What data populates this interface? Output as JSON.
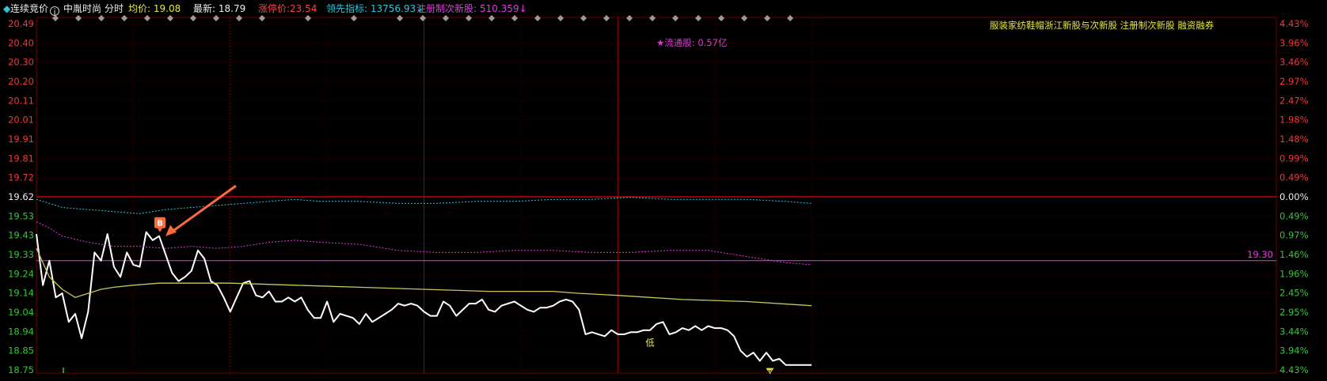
{
  "header": {
    "auction_label": "连续竞价",
    "stock_name": "中胤时尚",
    "mode_label": "分时",
    "avg_price": "均价: 19.08",
    "latest": "最新: 18.79",
    "limit_up": "涨停价:23.54",
    "lead_indicator": "领先指标: 13756.93↓",
    "registration": "注册制次新股: 510.359↓"
  },
  "tags": "服装家纺鞋帽浙江新股与次新股 注册制次新股 融资融券",
  "float_shares": "★流通股: 0.57亿",
  "buy_marker": "B",
  "low_marker": "低",
  "ref_price_label": "19.30",
  "colors": {
    "price_line": "#ffffff",
    "avg_line": "#c8c85a",
    "lead_line": "#28c8dc",
    "reg_line": "#dc3cdc",
    "grid": "#6e0000",
    "up": "#ff3232",
    "down": "#32c832",
    "accent": "#ff6a3c"
  },
  "chart_data": {
    "type": "line",
    "prev_close": 19.62,
    "y_ticks_left": [
      {
        "v": "20.49",
        "c": "up"
      },
      {
        "v": "20.40",
        "c": "up"
      },
      {
        "v": "20.30",
        "c": "up"
      },
      {
        "v": "20.20",
        "c": "up"
      },
      {
        "v": "20.11",
        "c": "up"
      },
      {
        "v": "20.01",
        "c": "up"
      },
      {
        "v": "19.91",
        "c": "up"
      },
      {
        "v": "19.81",
        "c": "up"
      },
      {
        "v": "19.72",
        "c": "up"
      },
      {
        "v": "19.62",
        "c": "flat"
      },
      {
        "v": "19.53",
        "c": "down"
      },
      {
        "v": "19.43",
        "c": "down"
      },
      {
        "v": "19.33",
        "c": "down"
      },
      {
        "v": "19.24",
        "c": "down"
      },
      {
        "v": "19.14",
        "c": "down"
      },
      {
        "v": "19.04",
        "c": "down"
      },
      {
        "v": "18.94",
        "c": "down"
      },
      {
        "v": "18.85",
        "c": "down"
      },
      {
        "v": "18.75",
        "c": "down"
      }
    ],
    "y_ticks_right": [
      {
        "v": "4.43%",
        "c": "up"
      },
      {
        "v": "3.96%",
        "c": "up"
      },
      {
        "v": "3.46%",
        "c": "up"
      },
      {
        "v": "2.97%",
        "c": "up"
      },
      {
        "v": "2.47%",
        "c": "up"
      },
      {
        "v": "1.98%",
        "c": "up"
      },
      {
        "v": "1.48%",
        "c": "up"
      },
      {
        "v": "0.99%",
        "c": "up"
      },
      {
        "v": "0.49%",
        "c": "up"
      },
      {
        "v": "0.00%",
        "c": "flat"
      },
      {
        "v": "0.49%",
        "c": "down"
      },
      {
        "v": "0.97%",
        "c": "down"
      },
      {
        "v": "1.46%",
        "c": "down"
      },
      {
        "v": "1.96%",
        "c": "down"
      },
      {
        "v": "2.45%",
        "c": "down"
      },
      {
        "v": "2.95%",
        "c": "down"
      },
      {
        "v": "3.44%",
        "c": "down"
      },
      {
        "v": "3.94%",
        "c": "down"
      },
      {
        "v": "4.43%",
        "c": "down"
      }
    ],
    "ylim": [
      18.75,
      20.49
    ],
    "session_minutes": 240,
    "ref_price": 19.3,
    "buy_minute": 38,
    "low_minute": 190,
    "series": [
      {
        "key": "price",
        "values": [
          [
            0,
            19.43
          ],
          [
            2,
            19.18
          ],
          [
            4,
            19.3
          ],
          [
            6,
            19.12
          ],
          [
            8,
            19.14
          ],
          [
            10,
            19.0
          ],
          [
            12,
            19.04
          ],
          [
            14,
            18.92
          ],
          [
            16,
            19.05
          ],
          [
            18,
            19.34
          ],
          [
            20,
            19.3
          ],
          [
            22,
            19.43
          ],
          [
            24,
            19.27
          ],
          [
            26,
            19.22
          ],
          [
            28,
            19.34
          ],
          [
            30,
            19.28
          ],
          [
            32,
            19.27
          ],
          [
            34,
            19.44
          ],
          [
            36,
            19.4
          ],
          [
            38,
            19.42
          ],
          [
            40,
            19.33
          ],
          [
            42,
            19.24
          ],
          [
            44,
            19.2
          ],
          [
            46,
            19.22
          ],
          [
            48,
            19.25
          ],
          [
            50,
            19.35
          ],
          [
            52,
            19.31
          ],
          [
            54,
            19.2
          ],
          [
            56,
            19.18
          ],
          [
            58,
            19.12
          ],
          [
            60,
            19.05
          ],
          [
            62,
            19.12
          ],
          [
            64,
            19.19
          ],
          [
            66,
            19.2
          ],
          [
            68,
            19.13
          ],
          [
            70,
            19.12
          ],
          [
            72,
            19.15
          ],
          [
            74,
            19.1
          ],
          [
            76,
            19.1
          ],
          [
            78,
            19.12
          ],
          [
            80,
            19.1
          ],
          [
            82,
            19.12
          ],
          [
            84,
            19.06
          ],
          [
            86,
            19.02
          ],
          [
            88,
            19.02
          ],
          [
            90,
            19.1
          ],
          [
            92,
            19.0
          ],
          [
            94,
            19.04
          ],
          [
            96,
            19.03
          ],
          [
            98,
            19.02
          ],
          [
            100,
            18.99
          ],
          [
            102,
            19.04
          ],
          [
            104,
            19.0
          ],
          [
            106,
            19.02
          ],
          [
            108,
            19.04
          ],
          [
            110,
            19.06
          ],
          [
            112,
            19.09
          ],
          [
            114,
            19.08
          ],
          [
            116,
            19.09
          ],
          [
            118,
            19.08
          ],
          [
            120,
            19.05
          ],
          [
            122,
            19.03
          ],
          [
            124,
            19.03
          ],
          [
            126,
            19.1
          ],
          [
            128,
            19.08
          ],
          [
            130,
            19.03
          ],
          [
            132,
            19.06
          ],
          [
            134,
            19.09
          ],
          [
            136,
            19.09
          ],
          [
            138,
            19.11
          ],
          [
            140,
            19.06
          ],
          [
            142,
            19.05
          ],
          [
            144,
            19.08
          ],
          [
            146,
            19.09
          ],
          [
            148,
            19.1
          ],
          [
            150,
            19.08
          ],
          [
            152,
            19.06
          ],
          [
            154,
            19.05
          ],
          [
            156,
            19.07
          ],
          [
            158,
            19.07
          ],
          [
            160,
            19.08
          ],
          [
            162,
            19.1
          ],
          [
            164,
            19.11
          ],
          [
            166,
            19.1
          ],
          [
            168,
            19.06
          ],
          [
            170,
            18.94
          ],
          [
            172,
            18.95
          ],
          [
            174,
            18.94
          ],
          [
            176,
            18.93
          ],
          [
            178,
            18.96
          ],
          [
            180,
            18.94
          ],
          [
            182,
            18.94
          ],
          [
            184,
            18.95
          ],
          [
            186,
            18.95
          ],
          [
            188,
            18.96
          ],
          [
            190,
            18.96
          ],
          [
            192,
            18.99
          ],
          [
            194,
            19.0
          ],
          [
            196,
            18.94
          ],
          [
            198,
            18.95
          ],
          [
            200,
            18.97
          ],
          [
            202,
            18.96
          ],
          [
            204,
            18.98
          ],
          [
            206,
            18.96
          ],
          [
            208,
            18.98
          ],
          [
            210,
            18.97
          ],
          [
            212,
            18.97
          ],
          [
            214,
            18.96
          ],
          [
            216,
            18.93
          ],
          [
            218,
            18.86
          ],
          [
            220,
            18.83
          ],
          [
            222,
            18.85
          ],
          [
            224,
            18.81
          ],
          [
            226,
            18.85
          ],
          [
            228,
            18.81
          ],
          [
            230,
            18.82
          ],
          [
            232,
            18.79
          ],
          [
            234,
            18.79
          ],
          [
            236,
            18.79
          ],
          [
            238,
            18.79
          ],
          [
            240,
            18.79
          ]
        ]
      },
      {
        "key": "avg",
        "values": [
          [
            0,
            19.36
          ],
          [
            4,
            19.22
          ],
          [
            8,
            19.16
          ],
          [
            12,
            19.12
          ],
          [
            16,
            19.14
          ],
          [
            20,
            19.16
          ],
          [
            24,
            19.17
          ],
          [
            30,
            19.18
          ],
          [
            38,
            19.19
          ],
          [
            46,
            19.19
          ],
          [
            60,
            19.19
          ],
          [
            80,
            19.18
          ],
          [
            100,
            19.17
          ],
          [
            120,
            19.16
          ],
          [
            140,
            19.15
          ],
          [
            160,
            19.15
          ],
          [
            168,
            19.14
          ],
          [
            180,
            19.13
          ],
          [
            200,
            19.11
          ],
          [
            220,
            19.1
          ],
          [
            240,
            19.08
          ]
        ]
      },
      {
        "key": "lead",
        "values": [
          [
            0,
            19.6
          ],
          [
            4,
            19.58
          ],
          [
            8,
            19.56
          ],
          [
            16,
            19.55
          ],
          [
            24,
            19.54
          ],
          [
            32,
            19.53
          ],
          [
            40,
            19.55
          ],
          [
            48,
            19.56
          ],
          [
            56,
            19.57
          ],
          [
            64,
            19.58
          ],
          [
            72,
            19.59
          ],
          [
            80,
            19.6
          ],
          [
            88,
            19.59
          ],
          [
            100,
            19.59
          ],
          [
            112,
            19.58
          ],
          [
            124,
            19.58
          ],
          [
            136,
            19.59
          ],
          [
            148,
            19.59
          ],
          [
            160,
            19.6
          ],
          [
            172,
            19.6
          ],
          [
            184,
            19.61
          ],
          [
            196,
            19.6
          ],
          [
            208,
            19.6
          ],
          [
            220,
            19.6
          ],
          [
            232,
            19.59
          ],
          [
            240,
            19.58
          ]
        ]
      },
      {
        "key": "reg",
        "values": [
          [
            0,
            19.49
          ],
          [
            4,
            19.46
          ],
          [
            8,
            19.42
          ],
          [
            16,
            19.39
          ],
          [
            24,
            19.37
          ],
          [
            32,
            19.37
          ],
          [
            40,
            19.36
          ],
          [
            48,
            19.37
          ],
          [
            56,
            19.36
          ],
          [
            64,
            19.37
          ],
          [
            72,
            19.39
          ],
          [
            80,
            19.4
          ],
          [
            88,
            19.39
          ],
          [
            100,
            19.38
          ],
          [
            112,
            19.35
          ],
          [
            124,
            19.34
          ],
          [
            136,
            19.34
          ],
          [
            148,
            19.35
          ],
          [
            160,
            19.35
          ],
          [
            172,
            19.34
          ],
          [
            184,
            19.34
          ],
          [
            196,
            19.35
          ],
          [
            208,
            19.35
          ],
          [
            220,
            19.32
          ],
          [
            232,
            19.29
          ],
          [
            240,
            19.28
          ]
        ]
      }
    ]
  }
}
